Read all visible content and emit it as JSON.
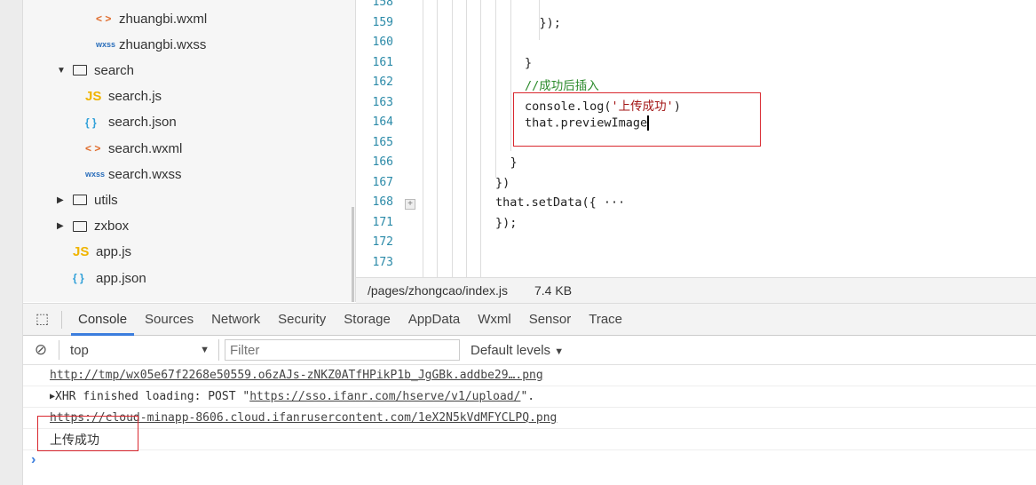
{
  "file_tree": [
    {
      "label": "zhuangbi.wxml",
      "icon": "wxml-icon",
      "glyph": "< >",
      "depth": 2
    },
    {
      "label": "zhuangbi.wxss",
      "icon": "wxss-icon",
      "glyph": "wxss",
      "depth": 2
    },
    {
      "label": "search",
      "icon": "folder-open-icon",
      "expanded": true,
      "depth": 0
    },
    {
      "label": "search.js",
      "icon": "js-icon",
      "glyph": "JS",
      "depth": 1
    },
    {
      "label": "search.json",
      "icon": "json-icon",
      "glyph": "{ }",
      "depth": 1
    },
    {
      "label": "search.wxml",
      "icon": "wxml-icon",
      "glyph": "< >",
      "depth": 1
    },
    {
      "label": "search.wxss",
      "icon": "wxss-icon",
      "glyph": "wxss",
      "depth": 1
    },
    {
      "label": "utils",
      "icon": "folder-icon",
      "expanded": false,
      "depth": 0
    },
    {
      "label": "zxbox",
      "icon": "folder-icon",
      "expanded": false,
      "depth": 0
    },
    {
      "label": "app.js",
      "icon": "js-icon",
      "glyph": "JS",
      "depth": -1
    },
    {
      "label": "app.json",
      "icon": "json-icon",
      "glyph": "{ }",
      "depth": -1
    }
  ],
  "editor": {
    "lines": [
      {
        "n": "158",
        "code": ""
      },
      {
        "n": "159",
        "code": "});",
        "indent": 8
      },
      {
        "n": "160",
        "code": ""
      },
      {
        "n": "161",
        "code": "}",
        "indent": 7
      },
      {
        "n": "162",
        "code": "//成功后插入",
        "indent": 7,
        "type": "comment"
      },
      {
        "n": "163",
        "code": "console.log(",
        "str": "'上传成功'",
        "after": ")",
        "indent": 7
      },
      {
        "n": "164",
        "code": "that.previewImage",
        "indent": 7,
        "cursor": true
      },
      {
        "n": "165",
        "code": ""
      },
      {
        "n": "166",
        "code": "}",
        "indent": 6
      },
      {
        "n": "167",
        "code": "})",
        "indent": 5
      },
      {
        "n": "168",
        "code": "that.setData({",
        "after": " ···",
        "indent": 5,
        "folded": true
      },
      {
        "n": "171",
        "code": "});",
        "indent": 5
      },
      {
        "n": "172",
        "code": ""
      },
      {
        "n": "173",
        "code": ""
      }
    ],
    "file_path": "/pages/zhongcao/index.js",
    "file_size": "7.4 KB"
  },
  "devtools": {
    "tabs": [
      "Console",
      "Sources",
      "Network",
      "Security",
      "Storage",
      "AppData",
      "Wxml",
      "Sensor",
      "Trace"
    ],
    "active_tab": "Console",
    "context": "top",
    "filter_placeholder": "Filter",
    "levels": "Default levels",
    "console": [
      {
        "type": "link",
        "text": "http://tmp/wx05e67f2268e50559.o6zAJs-zNKZ0ATfHPikP1b_JgGBk.addbe29….png"
      },
      {
        "type": "xhr",
        "prefix": "XHR finished loading: POST \"",
        "link": "https://sso.ifanr.com/hserve/v1/upload/",
        "suffix": "\"."
      },
      {
        "type": "link",
        "text": "https://cloud-minapp-8606.cloud.ifanrusercontent.com/1eX2N5kVdMFYCLPQ.png"
      },
      {
        "type": "text",
        "text": "上传成功"
      }
    ],
    "prompt": "›"
  },
  "colors": {
    "accent": "#3b7ddd",
    "highlight_box": "#d9282f",
    "line_number": "#2b8aa8"
  }
}
